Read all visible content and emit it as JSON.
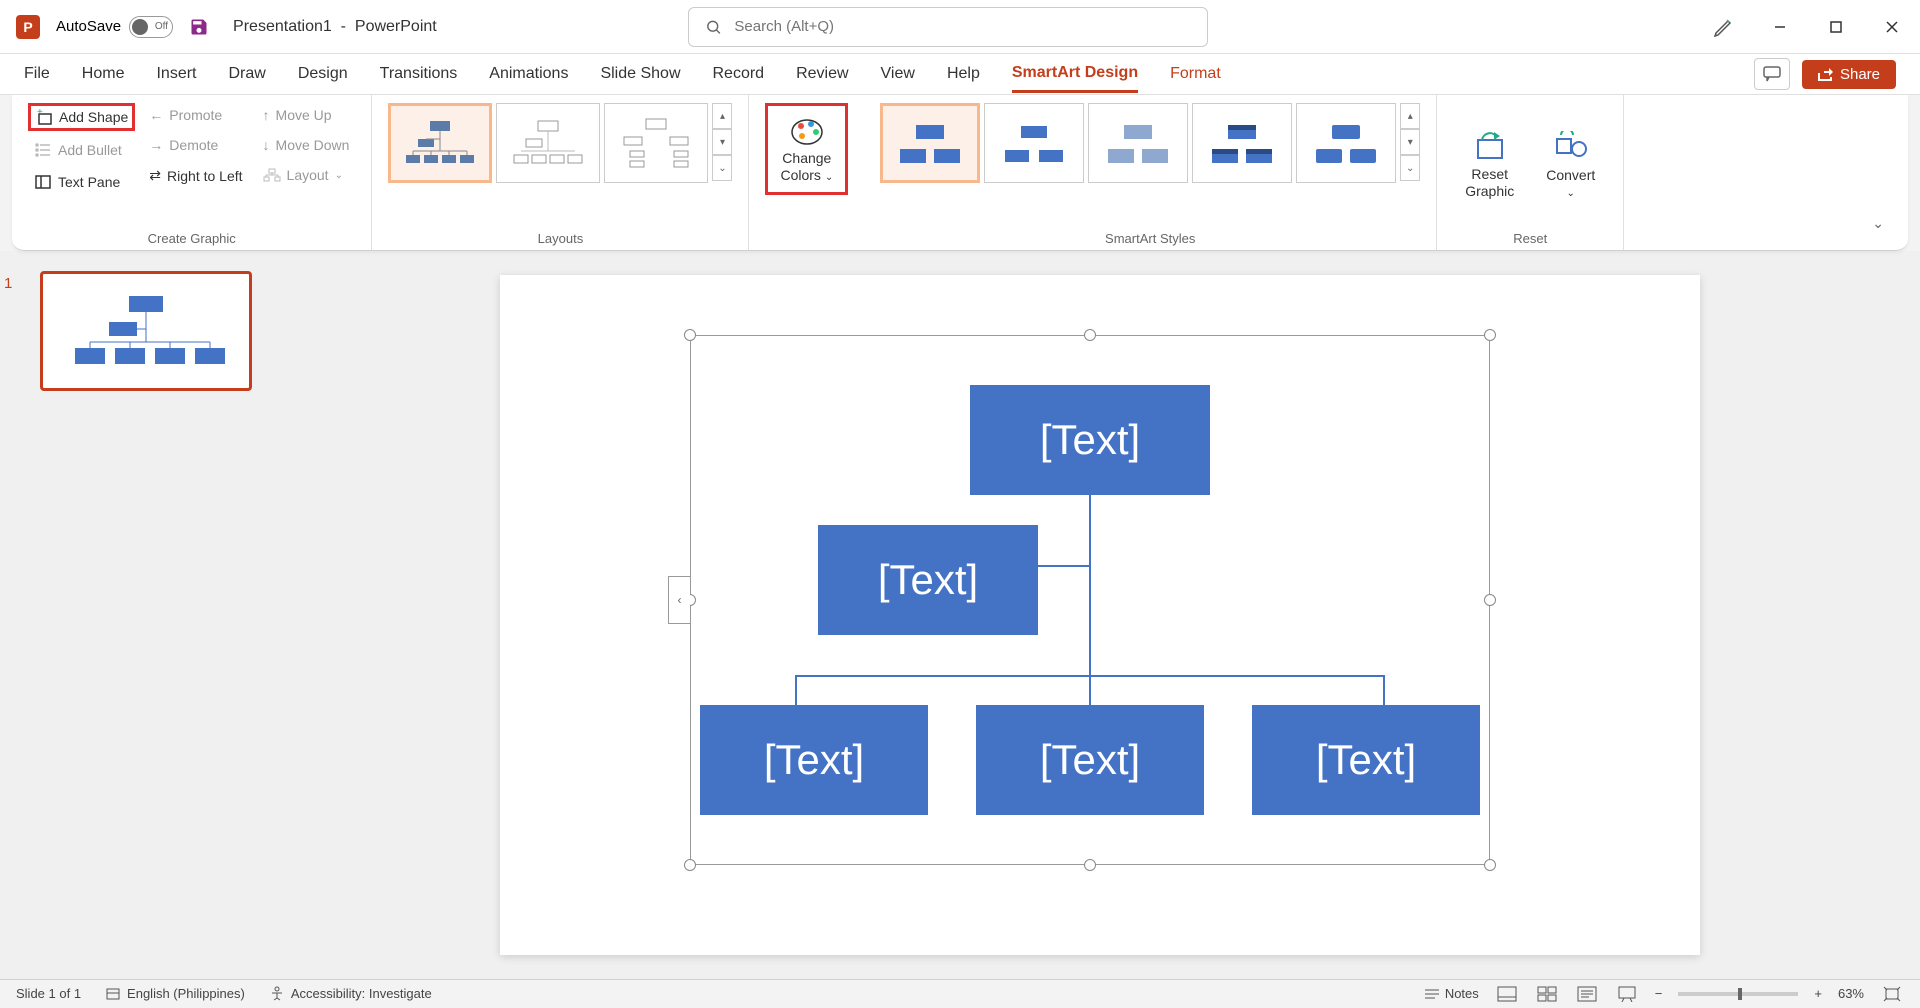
{
  "title": {
    "autosave_label": "AutoSave",
    "autosave_state": "Off",
    "document": "Presentation1",
    "app": "PowerPoint",
    "search_placeholder": "Search (Alt+Q)"
  },
  "tabs": {
    "file": "File",
    "home": "Home",
    "insert": "Insert",
    "draw": "Draw",
    "design": "Design",
    "transitions": "Transitions",
    "animations": "Animations",
    "slideshow": "Slide Show",
    "record": "Record",
    "review": "Review",
    "view": "View",
    "help": "Help",
    "smartart": "SmartArt Design",
    "format": "Format",
    "share": "Share"
  },
  "ribbon": {
    "create_graphic": {
      "add_shape": "Add Shape",
      "add_bullet": "Add Bullet",
      "text_pane": "Text Pane",
      "promote": "Promote",
      "demote": "Demote",
      "rtl": "Right to Left",
      "move_up": "Move Up",
      "move_down": "Move Down",
      "layout": "Layout",
      "label": "Create Graphic"
    },
    "layouts": {
      "label": "Layouts"
    },
    "change_colors": {
      "line1": "Change",
      "line2": "Colors"
    },
    "styles": {
      "label": "SmartArt Styles"
    },
    "reset": {
      "reset_graphic_l1": "Reset",
      "reset_graphic_l2": "Graphic",
      "convert": "Convert",
      "label": "Reset"
    }
  },
  "slide_panel": {
    "num": "1"
  },
  "smartart": {
    "node1": "[Text]",
    "node2": "[Text]",
    "node3": "[Text]",
    "node4": "[Text]",
    "node5": "[Text]"
  },
  "status": {
    "slide": "Slide 1 of 1",
    "lang": "English (Philippines)",
    "access": "Accessibility: Investigate",
    "notes": "Notes",
    "zoom": "63%"
  }
}
